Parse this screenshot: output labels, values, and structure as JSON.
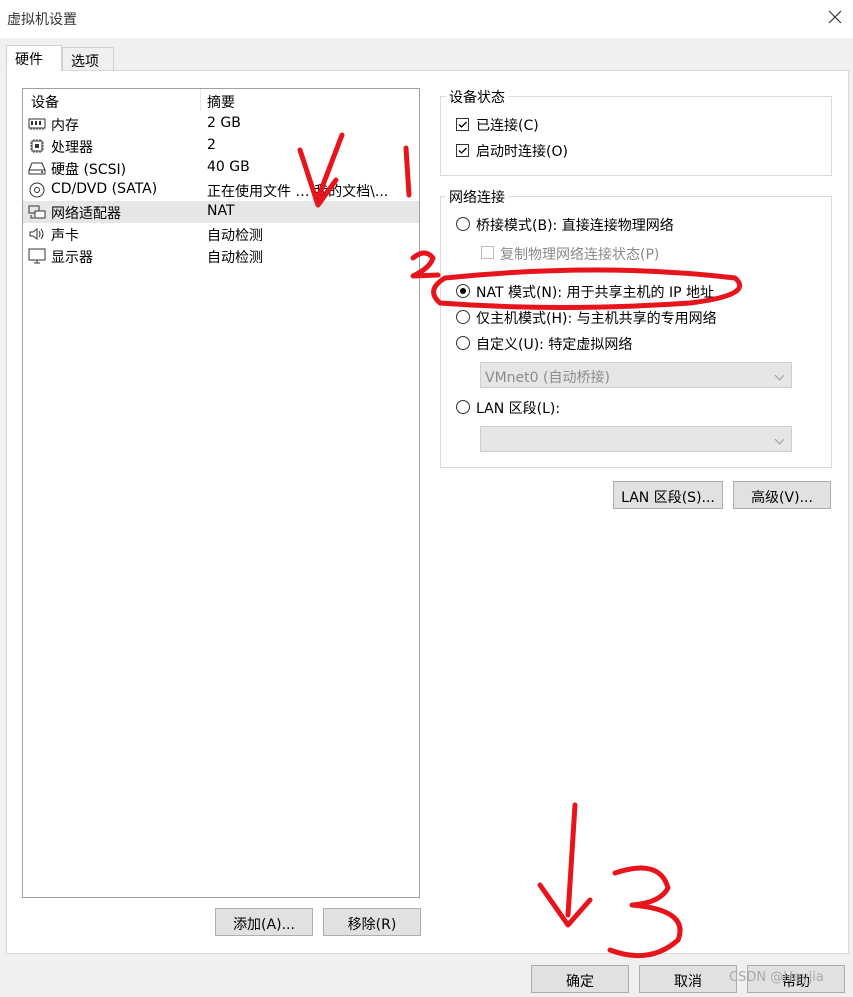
{
  "window": {
    "title": "虚拟机设置"
  },
  "tabs": [
    {
      "label": "硬件"
    },
    {
      "label": "选项"
    }
  ],
  "device_list": {
    "headers": {
      "device": "设备",
      "summary": "摘要"
    },
    "rows": [
      {
        "name": "内存",
        "summary": "2 GB",
        "icon": "memory-icon"
      },
      {
        "name": "处理器",
        "summary": "2",
        "icon": "cpu-icon"
      },
      {
        "name": "硬盘 (SCSI)",
        "summary": "40 GB",
        "icon": "harddisk-icon"
      },
      {
        "name": "CD/DVD (SATA)",
        "summary": "正在使用文件 …\\我的文档\\...",
        "icon": "cd-icon"
      },
      {
        "name": "网络适配器",
        "summary": "NAT",
        "icon": "network-icon",
        "selected": true
      },
      {
        "name": "声卡",
        "summary": "自动检测",
        "icon": "speaker-icon"
      },
      {
        "name": "显示器",
        "summary": "自动检测",
        "icon": "monitor-icon"
      }
    ]
  },
  "list_buttons": {
    "add": "添加(A)...",
    "remove": "移除(R)"
  },
  "device_status": {
    "legend": "设备状态",
    "connected": {
      "label": "已连接(C)",
      "checked": true
    },
    "connect_at_power_on": {
      "label": "启动时连接(O)",
      "checked": true
    }
  },
  "network": {
    "legend": "网络连接",
    "bridged": "桥接模式(B): 直接连接物理网络",
    "replicate": "复制物理网络连接状态(P)",
    "nat": "NAT 模式(N): 用于共享主机的 IP 地址",
    "host_only": "仅主机模式(H): 与主机共享的专用网络",
    "custom": "自定义(U): 特定虚拟网络",
    "custom_select": "VMnet0 (自动桥接)",
    "lan_segment": "LAN 区段(L):",
    "lan_select": "",
    "selected": "nat"
  },
  "network_buttons": {
    "lan_segments": "LAN 区段(S)...",
    "advanced": "高级(V)..."
  },
  "footer": {
    "ok": "确定",
    "cancel": "取消",
    "help": "帮助"
  },
  "annotations": {
    "step1": "1",
    "step2": "2",
    "step3": "3",
    "color": "#e8141b"
  },
  "watermark": "CSDN @Heyjia"
}
